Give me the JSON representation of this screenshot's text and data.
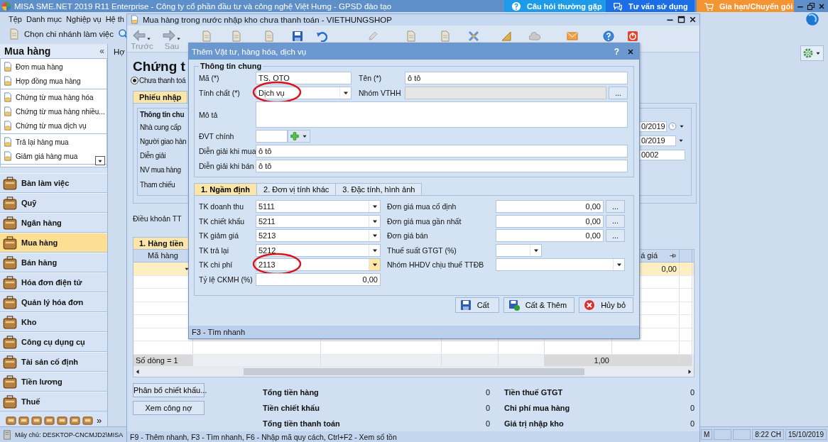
{
  "app": {
    "title": "MISA SME.NET 2019 R11 Enterprise - Công ty cổ phần đầu tư và công nghệ Việt Hưng - GPSD đào tạo",
    "help_buttons": [
      {
        "label": "Câu hỏi thường gặp",
        "kind": "faq"
      },
      {
        "label": "Tư vấn sử dụng",
        "kind": "consult"
      },
      {
        "label": "Gia hạn/Chuyển gói",
        "kind": "renew"
      }
    ],
    "menu": [
      "Tệp",
      "Danh mục",
      "Nghiệp vụ",
      "Hệ th"
    ],
    "branch_button": "Chọn chi nhánh làm việc",
    "open_tab": "Hợ",
    "sidebar": {
      "title": "Mua hàng",
      "collapse": "«",
      "link_groups": [
        [
          "Đơn mua hàng",
          "Hợp đồng mua hàng"
        ],
        [
          "Chứng từ mua hàng hóa",
          "Chứng từ mua hàng nhiều...",
          "Chứng từ mua dịch vụ"
        ],
        [
          "Trả lại hàng mua",
          "Giảm giá hàng mua"
        ]
      ],
      "modules": [
        {
          "label": "Bàn làm việc",
          "selected": false
        },
        {
          "label": "Quỹ",
          "selected": false
        },
        {
          "label": "Ngân hàng",
          "selected": false
        },
        {
          "label": "Mua hàng",
          "selected": true
        },
        {
          "label": "Bán hàng",
          "selected": false
        },
        {
          "label": "Hóa đơn điện tử",
          "selected": false
        },
        {
          "label": "Quản lý hóa đơn",
          "selected": false
        },
        {
          "label": "Kho",
          "selected": false
        },
        {
          "label": "Công cụ dụng cụ",
          "selected": false
        },
        {
          "label": "Tài sản cố định",
          "selected": false
        },
        {
          "label": "Tiền lương",
          "selected": false
        },
        {
          "label": "Thuế",
          "selected": false
        }
      ],
      "more": "»"
    },
    "status_bar": {
      "server": "Máy chủ: DESKTOP-CNCMJD2\\MISA",
      "cells": [
        "M",
        "8:22 CH",
        "15/10/2019"
      ]
    }
  },
  "document": {
    "title": "Mua hàng trong nước nhập kho chưa thanh toán - VIETHUNGSHOP",
    "nav": [
      {
        "label": "Trước",
        "kind": "back"
      },
      {
        "label": "Sau",
        "kind": "forward"
      }
    ],
    "heading": "Chứng t",
    "payment_option": {
      "label": "Chưa thanh toá",
      "selected": true
    },
    "tab": {
      "label": "Phiếu nhập",
      "selected": true
    },
    "group_title": "Thông tin chu",
    "labels": [
      "Nhà cung cấp",
      "Người giao hàn",
      "Diễn giải",
      "NV mua hàng",
      "Tham chiếu"
    ],
    "right_fields": [
      {
        "value": "0/2019",
        "kind": "date"
      },
      {
        "value": "0/2019",
        "kind": "combo"
      },
      {
        "value": "0002",
        "kind": "text"
      }
    ],
    "terms_label": "Điều khoản TT",
    "grid_tab": {
      "label": "1. Hàng tiền",
      "selected": true
    },
    "grid": {
      "columns": [
        "Mã hàng",
        "á giá"
      ],
      "rows": [
        {
          "selected": true,
          "amount": "0,00"
        }
      ],
      "footer": {
        "count": "Số dòng = 1",
        "total": "1,00"
      }
    },
    "actions": [
      "Phân bổ chiết khấu...",
      "Xem công nợ"
    ],
    "totals": [
      {
        "label": "Tổng tiền hàng",
        "value": "0"
      },
      {
        "label": "Tiền thuế GTGT",
        "value": "0"
      },
      {
        "label": "Tiền chiết khấu",
        "value": "0"
      },
      {
        "label": "Chi phí mua hàng",
        "value": "0"
      },
      {
        "label": "Tổng tiền thanh toán",
        "value": "0"
      },
      {
        "label": "Giá trị nhập kho",
        "value": "0"
      }
    ],
    "status": "F9 - Thêm nhanh, F3 - Tìm nhanh, F6 - Nhập mã quy cách, Ctrl+F2 - Xem số tồn"
  },
  "dialog": {
    "title": "Thêm Vật tư, hàng hóa, dịch vụ",
    "help": "?",
    "general": {
      "title": "Thông tin chung",
      "rows": [
        [
          {
            "label": "Mã (*)",
            "kind": "text",
            "value": "TS. OTO"
          },
          {
            "label": "Tên (*)",
            "kind": "text",
            "value": "ô tô"
          }
        ],
        [
          {
            "label": "Tính chất (*)",
            "kind": "combo",
            "value": "Dịch vụ",
            "highlighted": true
          },
          {
            "label": "Nhóm VTHH",
            "kind": "lookup",
            "disabled": true,
            "button": "..."
          }
        ],
        [
          {
            "label": "Mô tả",
            "kind": "memo"
          }
        ],
        [
          {
            "label": "ĐVT chính",
            "kind": "unit"
          }
        ],
        [
          {
            "label": "Diễn giải khi mua",
            "kind": "text",
            "value": "ô tô"
          }
        ],
        [
          {
            "label": "Diễn giải khi bán",
            "kind": "text",
            "value": "ô tô"
          }
        ]
      ]
    },
    "tabs": [
      {
        "label": "1. Ngầm định",
        "selected": true
      },
      {
        "label": "2. Đơn vị tính khác",
        "selected": false
      },
      {
        "label": "3. Đặc tính, hình ảnh",
        "selected": false
      }
    ],
    "accounts": [
      {
        "label": "TK doanh thu",
        "kind": "combo",
        "value": "5111"
      },
      {
        "label": "TK chiết khấu",
        "kind": "combo",
        "value": "5211"
      },
      {
        "label": "TK giảm giá",
        "kind": "combo",
        "value": "5213"
      },
      {
        "label": "TK trả lại",
        "kind": "combo",
        "value": "5212"
      },
      {
        "label": "TK chi phí",
        "kind": "combo",
        "value": "2113",
        "highlighted": true,
        "focused": true
      },
      {
        "label": "Tỷ lệ CKMH (%)",
        "kind": "number",
        "value": "0,00"
      }
    ],
    "prices": [
      {
        "label": "Đơn giá mua cố định",
        "kind": "number",
        "value": "0,00",
        "button": "..."
      },
      {
        "label": "Đơn giá mua gần nhất",
        "kind": "number",
        "value": "0,00",
        "button": "..."
      },
      {
        "label": "Đơn giá bán",
        "kind": "number",
        "value": "0,00",
        "button": "..."
      },
      {
        "label": "Thuế suất GTGT (%)",
        "kind": "short-combo"
      },
      {
        "label": "Nhóm HHDV chịu thuế TTĐB",
        "kind": "combo"
      }
    ],
    "buttons": [
      {
        "label": "Cất",
        "kind": "save"
      },
      {
        "label": "Cất & Thêm",
        "kind": "save-new"
      },
      {
        "label": "Hủy bỏ",
        "kind": "cancel"
      }
    ],
    "status": "F3 - Tìm nhanh"
  }
}
